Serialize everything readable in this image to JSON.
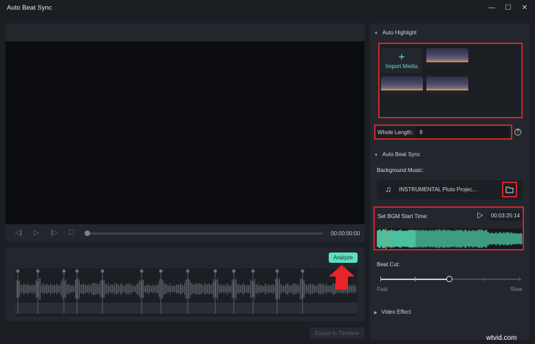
{
  "window": {
    "title": "Auto Beat Sync",
    "controls": [
      "minimize",
      "maximize",
      "close"
    ]
  },
  "player": {
    "timecode": "00:00:00:00",
    "progress": 0,
    "controls": [
      "previous-frame",
      "play",
      "next-frame",
      "stop"
    ]
  },
  "beat_panel": {
    "analyze_label": "Analyze",
    "export_label": "Export to Timeline"
  },
  "sidebar": {
    "auto_highlight": {
      "title": "Auto Highlight",
      "import_label": "Import Media",
      "thumbnail_count": 3
    },
    "whole_length": {
      "label": "Whole Length:",
      "value": "9"
    },
    "auto_beat_sync": {
      "title": "Auto Beat Sync",
      "bg_music_label": "Background Music:",
      "music_name": "INSTRUMENTAL  Pluto Projec...",
      "bgm_label": "Set BGM Start Time:",
      "bgm_time": "00:03:25:14"
    },
    "beat_cut": {
      "label": "Beat Cut:",
      "fast": "Fast",
      "slow": "Slow",
      "level": 3,
      "levels": 5
    },
    "video_effect": {
      "title": "Video Effect"
    }
  },
  "colors": {
    "accent": "#5ce0c0",
    "highlight_box": "#d0262f",
    "arrow": "#e8232a"
  },
  "watermark": "wtvid.com"
}
